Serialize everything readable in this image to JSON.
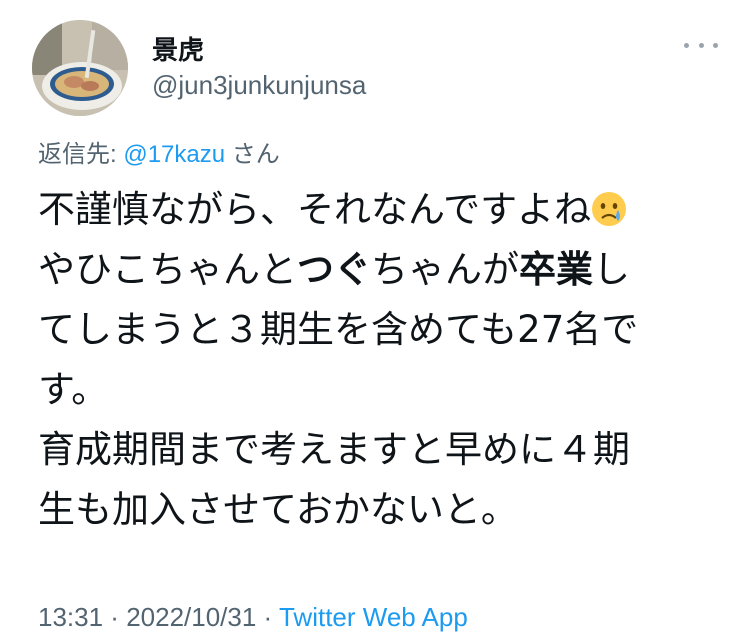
{
  "tweet": {
    "avatar": "ramen-bowl-photo",
    "display_name": "景虎",
    "handle": "@jun3junkunjunsa",
    "more_icon": "more-horizontal-icon",
    "reply_prefix": "返信先: ",
    "reply_mention": "@17kazu",
    "reply_suffix": " さん",
    "lines": {
      "l1": "不謹慎ながら、それなんですよね",
      "emoji": "crying-face-emoji",
      "l2a": "やひこちゃんと",
      "l2b": "つぐ",
      "l2c": "ちゃんが",
      "l2d": "卒業",
      "l2e": "し",
      "l3": "てしまうと３期生を含めても27名で",
      "l4": "す。",
      "l5": "育成期間まで考えますと早めに４期",
      "l6": "生も加入させておかないと。"
    },
    "time": "13:31",
    "sep1": " · ",
    "date": "2022/10/31",
    "sep2": " · ",
    "source": "Twitter Web App"
  },
  "colors": {
    "link": "#1d9bf0",
    "secondary": "#536471",
    "text": "#0f1419"
  }
}
